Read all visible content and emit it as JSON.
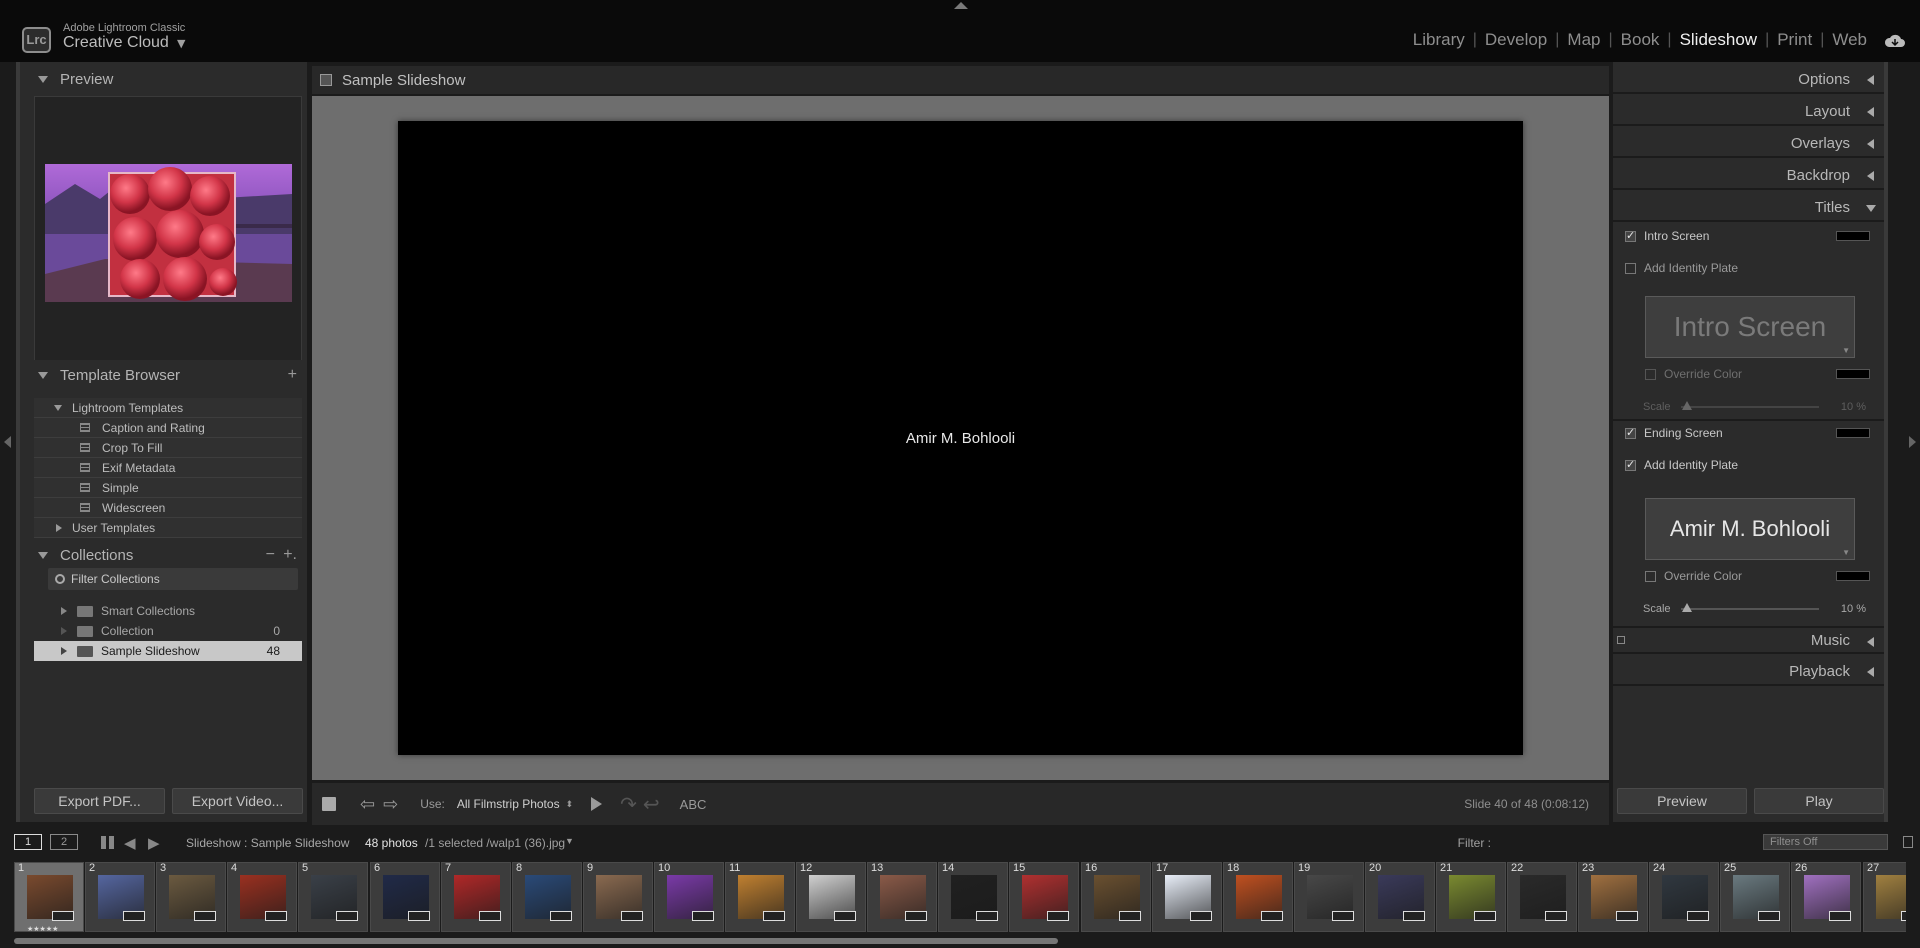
{
  "app": {
    "logo": "Lrc",
    "product_small": "Adobe Lightroom Classic",
    "product_big": "Creative Cloud",
    "product_caret": "▼",
    "modules": [
      "Library",
      "Develop",
      "Map",
      "Book",
      "Slideshow",
      "Print",
      "Web"
    ],
    "active_module": "Slideshow",
    "separator": "|"
  },
  "left": {
    "preview_title": "Preview",
    "template_browser_title": "Template Browser",
    "template_add": "+",
    "templates_folder": "Lightroom Templates",
    "templates": [
      "Caption and Rating",
      "Crop To Fill",
      "Exif Metadata",
      "Simple",
      "Widescreen"
    ],
    "user_templates": "User Templates",
    "collections_title": "Collections",
    "collections_minus": "−",
    "collections_plus": "+.",
    "filter_placeholder": "Filter Collections",
    "collections": [
      {
        "name": "Smart Collections",
        "count": ""
      },
      {
        "name": "Collection",
        "count": "0"
      },
      {
        "name": "Sample Slideshow",
        "count": "48"
      }
    ],
    "export_pdf": "Export PDF...",
    "export_video": "Export Video..."
  },
  "center": {
    "title": "Sample Slideshow",
    "slide_text": "Amir M. Bohlooli",
    "toolbar": {
      "prev": "⇦",
      "next": "⇨",
      "use_label": "Use:",
      "use_value": "All Filmstrip Photos",
      "use_caret": "⬍",
      "rotate_left": "↷",
      "rotate_right": "↩",
      "abc": "ABC",
      "status": "Slide 40 of 48 (0:08:12)"
    }
  },
  "right": {
    "panels": [
      "Options",
      "Layout",
      "Overlays",
      "Backdrop",
      "Titles"
    ],
    "titles": {
      "intro_screen": "Intro Screen",
      "add_identity_plate": "Add Identity Plate",
      "intro_plate_text": "Intro Screen",
      "override_color": "Override Color",
      "scale_label": "Scale",
      "intro_scale_value": "10 %",
      "ending_screen": "Ending Screen",
      "add_identity_plate_2": "Add Identity Plate",
      "ending_plate_text": "Amir M. Bohlooli",
      "override_color_2": "Override Color",
      "scale_label_2": "Scale",
      "ending_scale_value": "10 %",
      "intro_checked": true,
      "intro_identity_checked": false,
      "ending_checked": true,
      "ending_identity_checked": true
    },
    "music": "Music",
    "playback": "Playback",
    "preview_btn": "Preview",
    "play_btn": "Play"
  },
  "filmstrip_bar": {
    "screen1": "1",
    "screen2": "2",
    "back": "◀",
    "forward": "▶",
    "path": "Slideshow : Sample Slideshow",
    "count": "48 photos",
    "selection": "/1 selected  /walp1 (36).jpg",
    "caret": "▼",
    "filter_label": "Filter :",
    "filter_value": "Filters Off"
  },
  "filmstrip": {
    "cells": [
      {
        "n": "1",
        "color": "#7a4a2e",
        "stars": "★★★★★"
      },
      {
        "n": "2",
        "color": "#5566a0"
      },
      {
        "n": "3",
        "color": "#6b5a40"
      },
      {
        "n": "4",
        "color": "#9a3020"
      },
      {
        "n": "5",
        "color": "#3a4048"
      },
      {
        "n": "6",
        "color": "#202a48"
      },
      {
        "n": "7",
        "color": "#b02828"
      },
      {
        "n": "8",
        "color": "#2a4a78"
      },
      {
        "n": "9",
        "color": "#8a6a50"
      },
      {
        "n": "10",
        "color": "#7a3aa8"
      },
      {
        "n": "11",
        "color": "#c08030"
      },
      {
        "n": "12",
        "color": "#d0d0d0"
      },
      {
        "n": "13",
        "color": "#8a5a48"
      },
      {
        "n": "14",
        "color": "#202020"
      },
      {
        "n": "15",
        "color": "#b03030"
      },
      {
        "n": "16",
        "color": "#6a5030"
      },
      {
        "n": "17",
        "color": "#e8eef8"
      },
      {
        "n": "18",
        "color": "#c05020"
      },
      {
        "n": "19",
        "color": "#484848"
      },
      {
        "n": "20",
        "color": "#3a3a5a"
      },
      {
        "n": "21",
        "color": "#7a8a30"
      },
      {
        "n": "22",
        "color": "#2a2a2a"
      },
      {
        "n": "23",
        "color": "#a07040"
      },
      {
        "n": "24",
        "color": "#303840"
      },
      {
        "n": "25",
        "color": "#6a7a80"
      },
      {
        "n": "26",
        "color": "#a070c0"
      },
      {
        "n": "27",
        "color": "#a08040"
      }
    ]
  }
}
